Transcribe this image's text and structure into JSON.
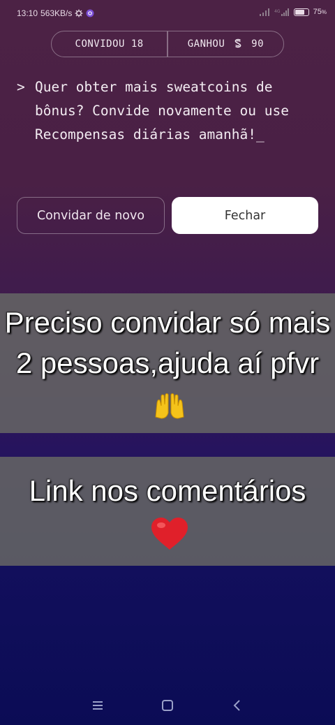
{
  "status_bar": {
    "time": "13:10",
    "net_speed": "563KB/s",
    "battery_percent": "75",
    "battery_level": 0.75
  },
  "stats": {
    "invited_label": "CONVIDOU 18",
    "earned_label": "GANHOU",
    "earned_value": "90"
  },
  "message": {
    "prompt": ">",
    "text": "Quer obter mais sweatcoins de bônus? Convide novamente ou use Recompensas diárias amanhã!_"
  },
  "buttons": {
    "invite_again": "Convidar de novo",
    "close": "Fechar"
  },
  "captions": {
    "caption_1": "Preciso convidar só mais 2 pessoas,ajuda aí pfvr",
    "caption_2": "Link nos comentários"
  },
  "icons": {
    "raised_hands": "raised-hands-icon",
    "heart": "red-heart-icon",
    "sweatcoin": "sweatcoin-icon"
  },
  "colors": {
    "heart": "#e0202a",
    "hands": "#f5c31a"
  }
}
